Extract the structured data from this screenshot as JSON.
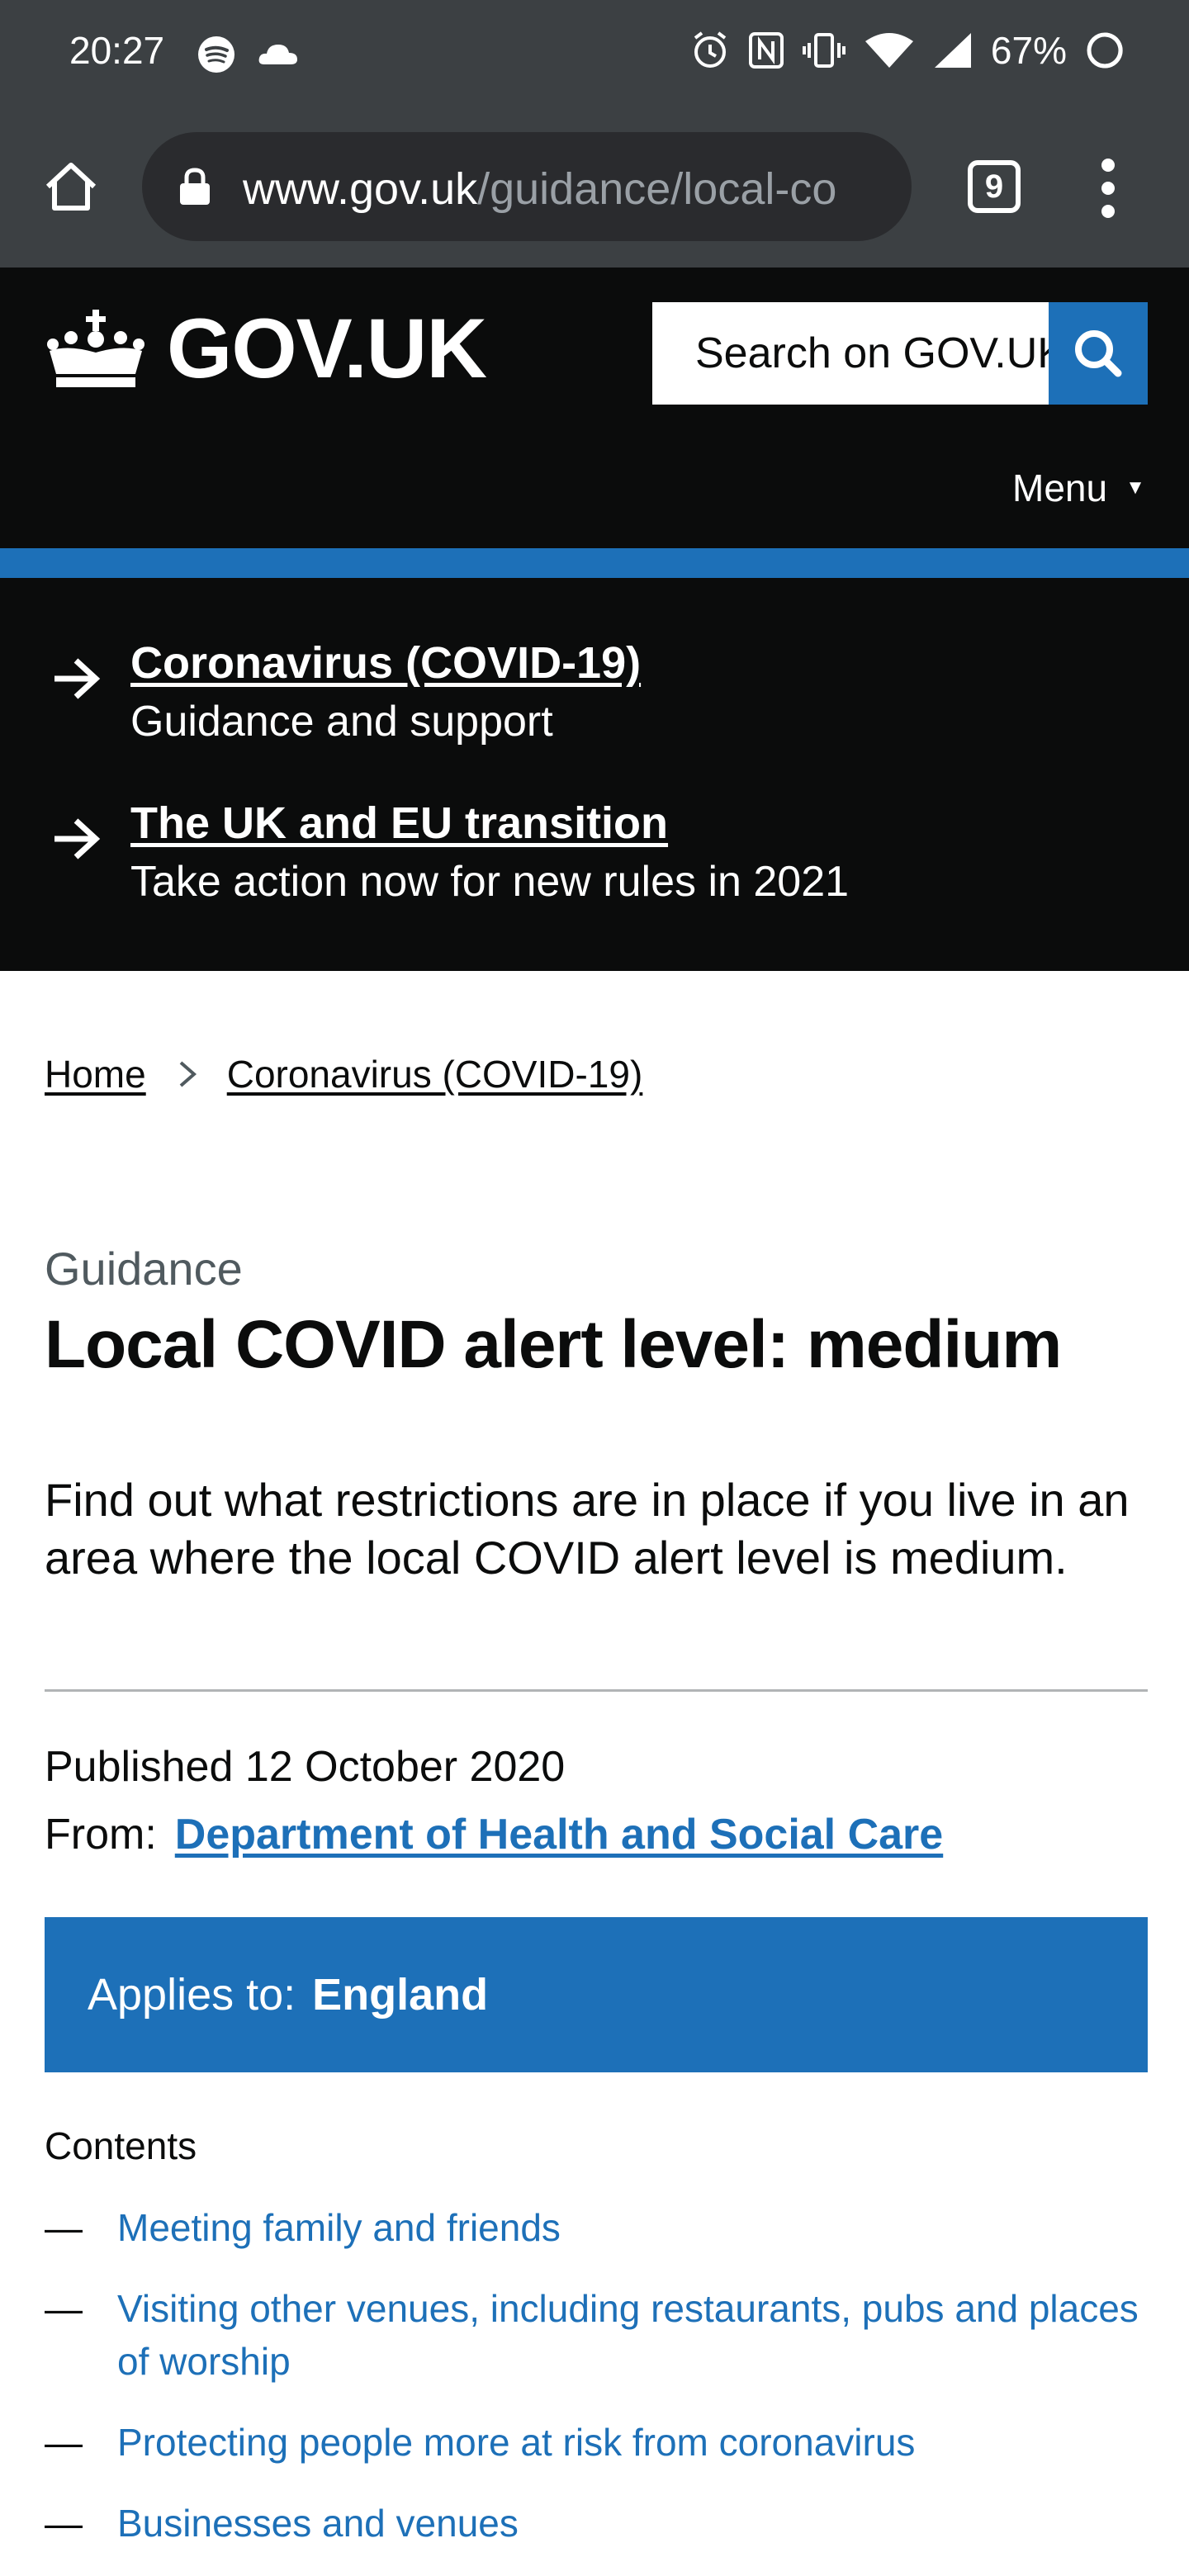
{
  "status_bar": {
    "time": "20:27",
    "battery": "67%",
    "icons": [
      "spotify-icon",
      "cloud-icon",
      "alarm-icon",
      "nfc-icon",
      "vibrate-icon",
      "wifi-icon",
      "signal-icon",
      "battery-icon"
    ]
  },
  "browser": {
    "url_domain": "www.gov.uk",
    "url_path": "/guidance/local-co",
    "tab_count": "9"
  },
  "header": {
    "logo_text": "GOV.UK",
    "search_placeholder": "Search on GOV.UK",
    "menu_label": "Menu",
    "menu_caret": "▼"
  },
  "notices": [
    {
      "title": "Coronavirus (COVID-19)",
      "description": "Guidance and support"
    },
    {
      "title": "The UK and EU transition",
      "description": "Take action now for new rules in 2021"
    }
  ],
  "breadcrumb": [
    "Home",
    "Coronavirus (COVID-19)"
  ],
  "main": {
    "caption": "Guidance",
    "title": "Local COVID alert level: medium",
    "lead": "Find out what restrictions are in place if you live in an area where the local COVID alert level is medium.",
    "published": "Published 12 October 2020",
    "from_label": "From:",
    "from_org": "Department of Health and Social Care",
    "applies_label": "Applies to:",
    "applies_value": "England"
  },
  "contents": {
    "heading": "Contents",
    "dash": "—",
    "items": [
      "Meeting family and friends",
      "Visiting other venues, including restaurants, pubs and places of worship",
      "Protecting people more at risk from coronavirus",
      "Businesses and venues"
    ]
  },
  "colors": {
    "gov_black": "#0b0c0c",
    "gov_blue": "#1d70b8",
    "chrome_grey": "#3c4043"
  }
}
